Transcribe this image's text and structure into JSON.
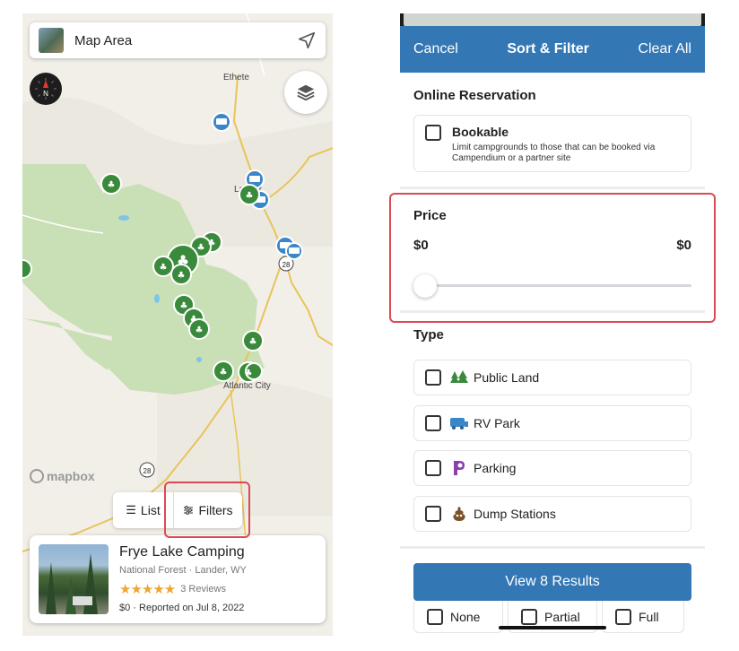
{
  "map": {
    "search_label": "Map Area",
    "compass_label": "N",
    "towns": [
      "Ethete",
      "Lander",
      "Atlantic City"
    ],
    "road_labels": [
      "28",
      "28"
    ],
    "attribution": "mapbox",
    "list_button": "List",
    "filters_button": "Filters",
    "card": {
      "title": "Frye Lake Camping",
      "subtitle": "National Forest · Lander, WY",
      "stars": "★★★★★",
      "reviews": "3 Reviews",
      "price_line": "$0 · Reported on Jul 8, 2022"
    },
    "colors": {
      "forest": "#c9dfb6",
      "water": "#7fc4e8",
      "pin_green": "#3a8a3c",
      "pin_blue": "#3a86c8",
      "highlight": "#d94a55"
    }
  },
  "filter": {
    "header": {
      "cancel": "Cancel",
      "title": "Sort & Filter",
      "clear": "Clear All"
    },
    "online_reservation": {
      "heading": "Online Reservation",
      "bookable_title": "Bookable",
      "bookable_desc": "Limit campgrounds to those that can be booked via Campendium or a partner site"
    },
    "price": {
      "heading": "Price",
      "min_label": "$0",
      "max_label": "$0",
      "slider_value": 0
    },
    "type": {
      "heading": "Type",
      "options": [
        {
          "label": "Public Land",
          "icon": "trees-icon"
        },
        {
          "label": "RV Park",
          "icon": "rv-icon"
        },
        {
          "label": "Parking",
          "icon": "parking-icon"
        },
        {
          "label": "Dump Stations",
          "icon": "dump-station-icon"
        }
      ]
    },
    "view_results": "View 8 Results",
    "hookups": [
      "None",
      "Partial",
      "Full"
    ],
    "colors": {
      "header": "#3477b5",
      "button": "#3477b5"
    }
  }
}
